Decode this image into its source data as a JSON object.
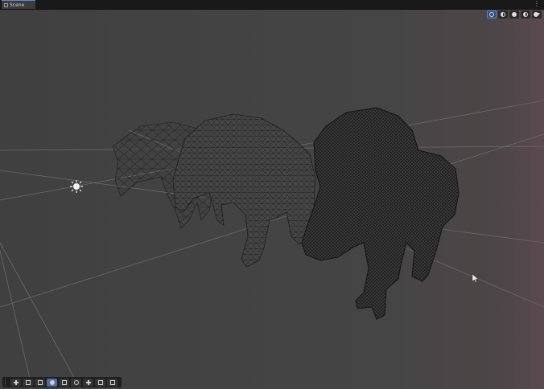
{
  "window": {
    "tab_label": "Scene",
    "menu_glyph": "⋮"
  },
  "scene_overlay": {
    "buttons": [
      {
        "icon": "orientation-gizmo-icon",
        "active": true
      },
      {
        "icon": "wireframe-shading-icon",
        "active": false
      },
      {
        "icon": "shaded-shading-icon",
        "active": false
      },
      {
        "icon": "shaded-wireframe-icon",
        "active": false
      },
      {
        "icon": "draw-mode-dropdown-icon",
        "active": false
      }
    ],
    "dropdown_glyph": "▾"
  },
  "tools": [
    {
      "name": "view-tool-icon",
      "active": false
    },
    {
      "name": "move-tool-icon",
      "active": false
    },
    {
      "name": "rotate-tool-icon",
      "active": false
    },
    {
      "name": "shaded-mode-icon",
      "active": true
    },
    {
      "name": "wireframe-mode-icon",
      "active": false
    },
    {
      "name": "zoom-tool-icon",
      "active": false
    },
    {
      "name": "transform-tool-icon",
      "active": false
    },
    {
      "name": "snap-icon",
      "active": false
    },
    {
      "name": "custom-tool-icon",
      "active": false
    }
  ],
  "scene": {
    "objects": [
      "low-poly-horse-wireframe",
      "medium-poly-horse-wireframe",
      "high-poly-horse-wireframe"
    ],
    "light": "directional-light-gizmo",
    "colors": {
      "grid": "#6a6a6a",
      "wire": "#1c1c1c",
      "accent": "#5c8ad1"
    }
  }
}
